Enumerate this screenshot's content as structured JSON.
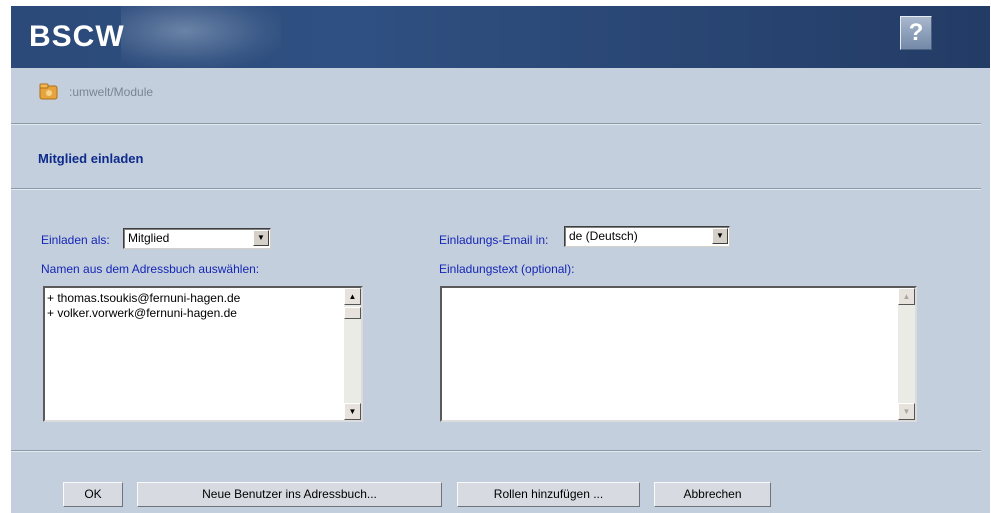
{
  "app": {
    "logo": "BSCW",
    "help_label": "?"
  },
  "breadcrumb": {
    "path": ":umwelt/Module"
  },
  "form": {
    "title": "Mitglied einladen",
    "invite_as_label": "Einladen als:",
    "invite_as_value": "Mitglied",
    "email_lang_label": "Einladungs-Email in:",
    "email_lang_value": "de (Deutsch)",
    "addressbook_label": "Namen aus dem Adressbuch auswählen:",
    "invite_text_label": "Einladungstext (optional):",
    "names": [
      "+ thomas.tsoukis@fernuni-hagen.de",
      "+ volker.vorwerk@fernuni-hagen.de"
    ],
    "invite_text_value": ""
  },
  "buttons": {
    "ok": "OK",
    "new_users": "Neue Benutzer ins Adressbuch...",
    "add_roles": "Rollen hinzufügen ...",
    "cancel": "Abbrechen"
  },
  "icons": {
    "folder": "folder-icon",
    "dropdown": "chevron-down-icon",
    "scroll_up": "scroll-up-icon",
    "scroll_down": "scroll-down-icon"
  }
}
